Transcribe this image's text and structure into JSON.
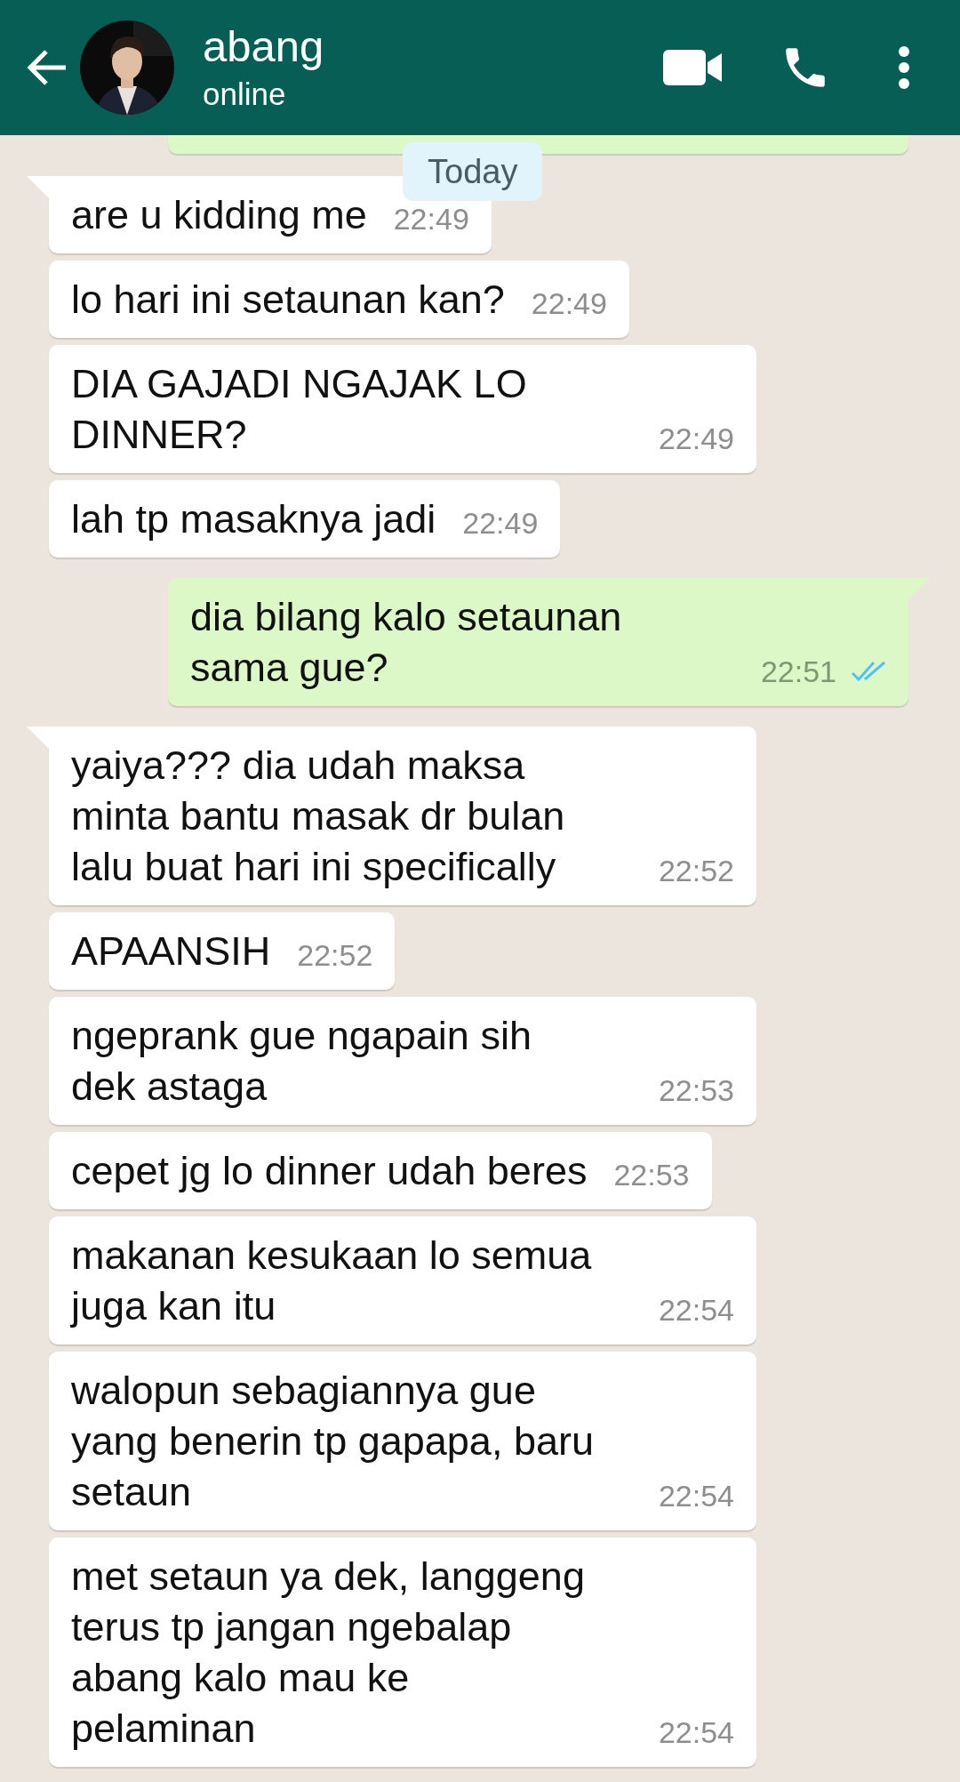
{
  "header": {
    "contact_name": "abang",
    "status": "online"
  },
  "messages": [
    {
      "kind": "outgoing-cut"
    },
    {
      "kind": "incoming",
      "tail": true,
      "lines": [
        "are u kidding me"
      ],
      "time": "22:49"
    },
    {
      "kind": "incoming",
      "tail": false,
      "lines": [
        "lo hari ini setaunan kan?"
      ],
      "time": "22:49"
    },
    {
      "kind": "incoming",
      "tail": false,
      "lines": [
        "DIA GAJADI NGAJAK LO",
        "DINNER?"
      ],
      "time": "22:49"
    },
    {
      "kind": "incoming",
      "tail": false,
      "lines": [
        "lah tp masaknya jadi"
      ],
      "time": "22:49"
    },
    {
      "kind": "outgoing",
      "tail": true,
      "lines": [
        "dia bilang kalo setaunan",
        "sama gue?"
      ],
      "time": "22:51",
      "read": true
    },
    {
      "kind": "incoming",
      "tail": true,
      "lines": [
        "yaiya??? dia udah maksa",
        "minta bantu masak dr bulan",
        "lalu buat hari ini specifically"
      ],
      "time": "22:52"
    },
    {
      "kind": "incoming",
      "tail": false,
      "lines": [
        "APAANSIH"
      ],
      "time": "22:52"
    },
    {
      "kind": "incoming",
      "tail": false,
      "lines": [
        "ngeprank gue ngapain sih",
        "dek astaga"
      ],
      "time": "22:53"
    },
    {
      "kind": "incoming",
      "tail": false,
      "lines": [
        "cepet jg lo dinner udah beres"
      ],
      "time": "22:53"
    },
    {
      "kind": "incoming",
      "tail": false,
      "lines": [
        "makanan kesukaan lo semua",
        "juga kan itu"
      ],
      "time": "22:54"
    },
    {
      "kind": "incoming",
      "tail": false,
      "lines": [
        "walopun sebagiannya gue",
        "yang benerin tp gapapa, baru",
        "setaun"
      ],
      "time": "22:54"
    },
    {
      "kind": "incoming",
      "tail": false,
      "lines": [
        "met setaun ya dek, langgeng",
        "terus tp jangan ngebalap",
        "abang kalo mau ke",
        "pelaminan"
      ],
      "time": "22:54"
    }
  ],
  "date_badge": "Today"
}
